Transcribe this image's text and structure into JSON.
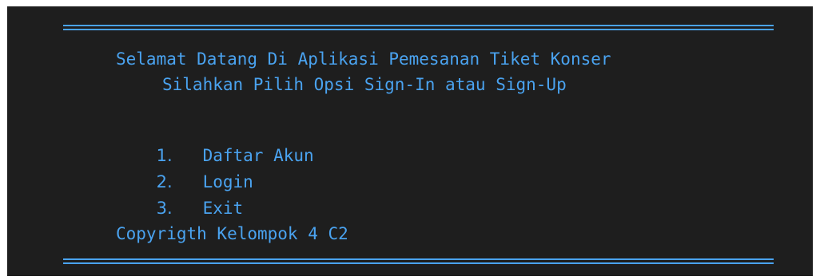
{
  "theme": {
    "background": "#1e1e1e",
    "text_color": "#4aa3f0",
    "page_background": "#ffffff"
  },
  "header": {
    "title_line_1": "Selamat Datang Di Aplikasi Pemesanan Tiket Konser",
    "title_line_2": "Silahkan Pilih Opsi Sign-In atau Sign-Up"
  },
  "menu": {
    "items": [
      {
        "number": "1.",
        "label": "Daftar Akun"
      },
      {
        "number": "2.",
        "label": "Login"
      },
      {
        "number": "3.",
        "label": "Exit"
      }
    ]
  },
  "footer": {
    "copyright": "Copyrigth Kelompok 4 C2"
  }
}
